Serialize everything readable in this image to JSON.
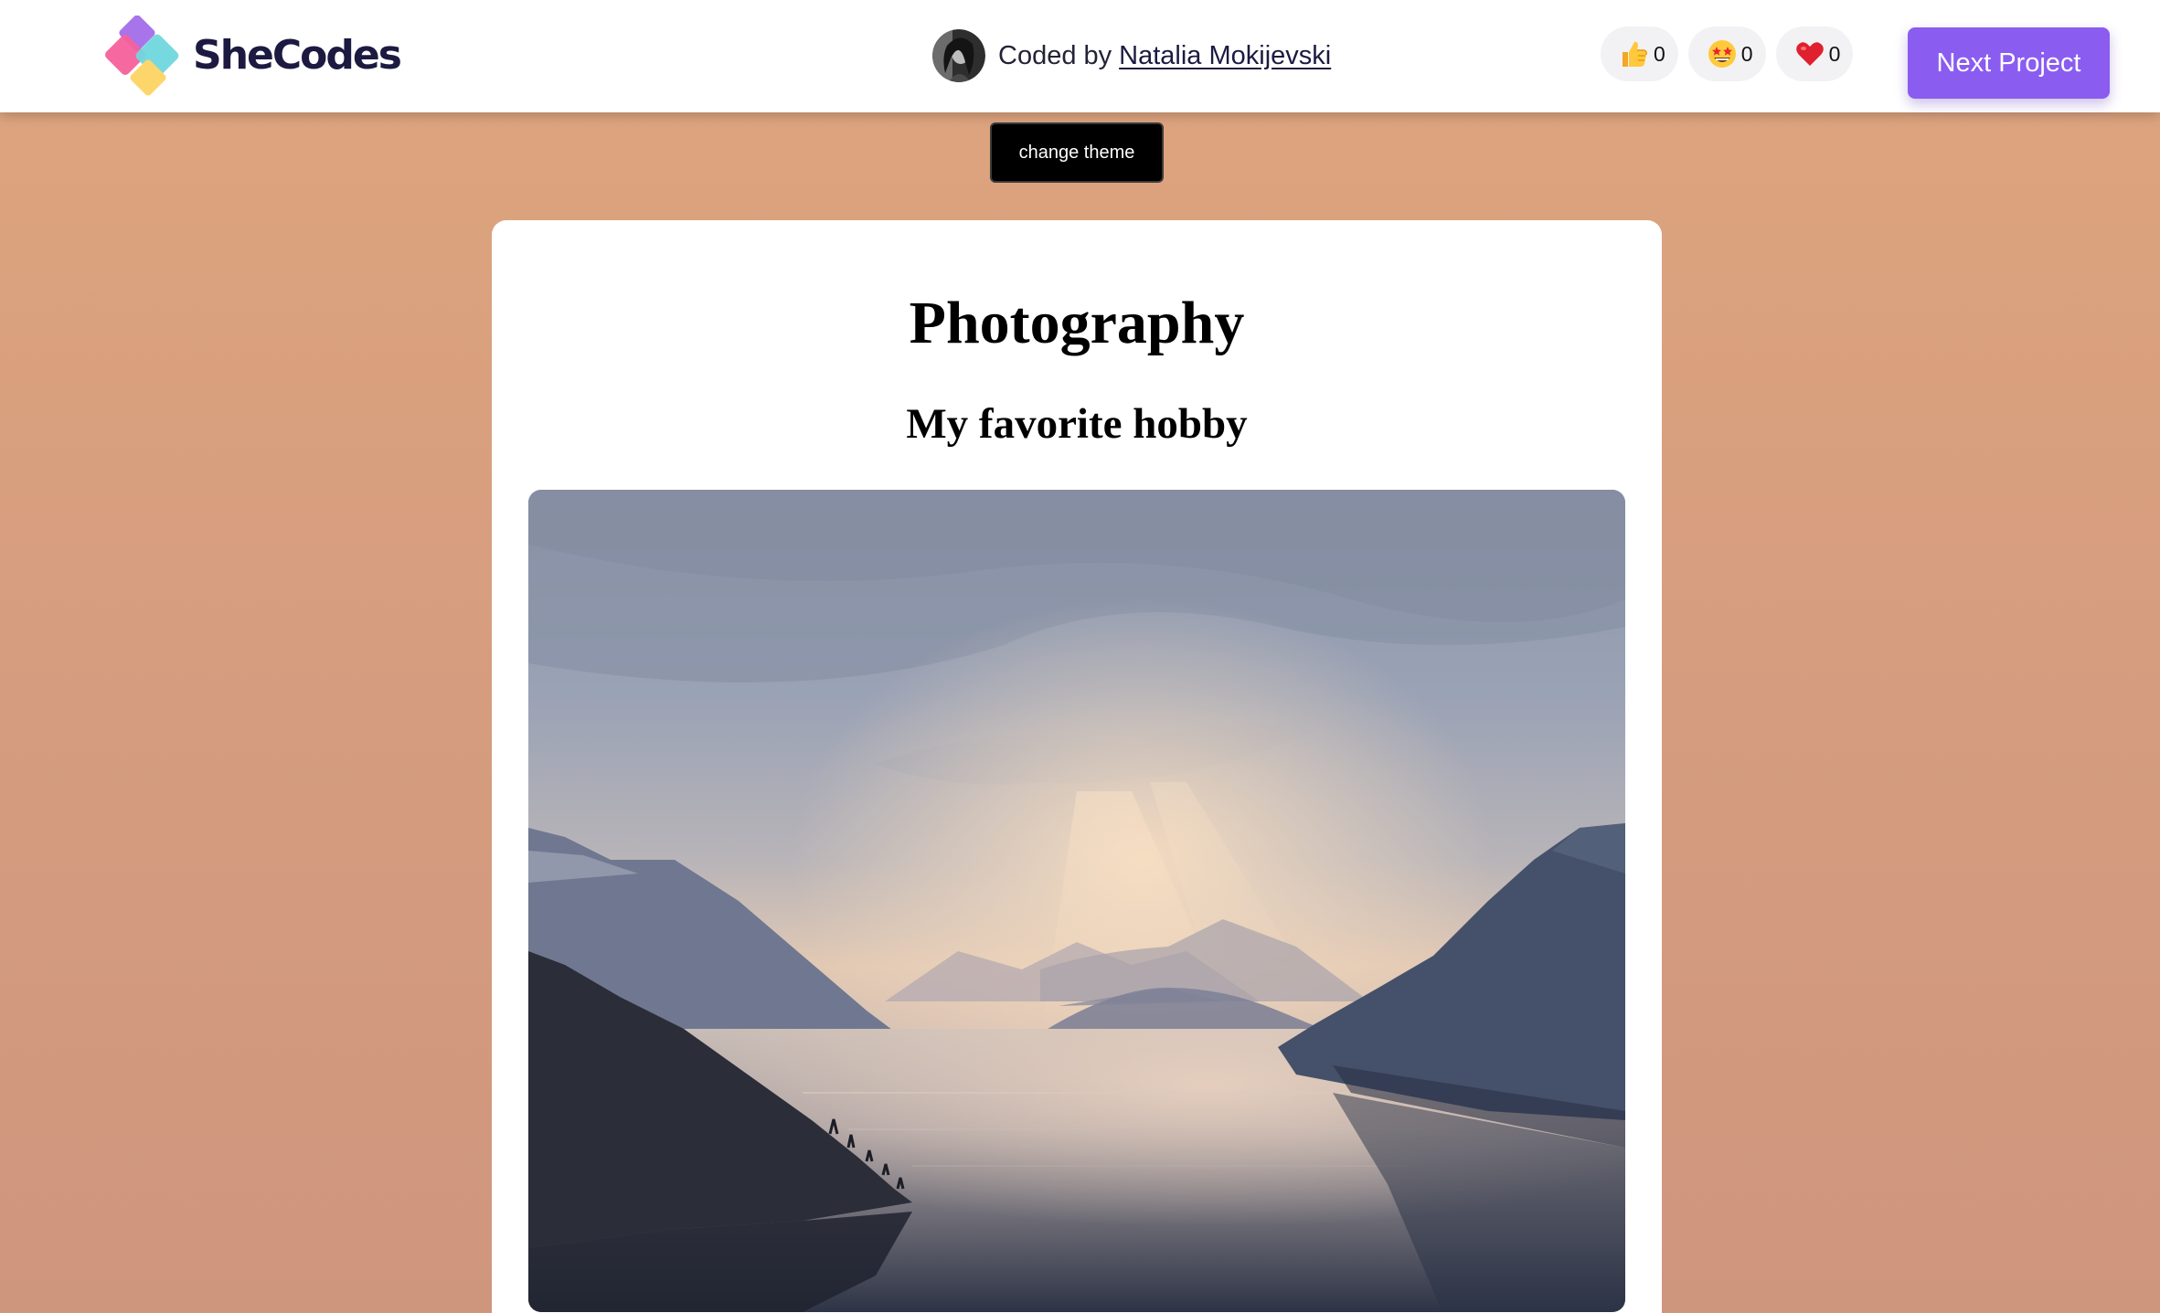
{
  "header": {
    "brand": "SheCodes",
    "coded_prefix": "Coded by",
    "author_name": "Natalia Mokijevski",
    "reactions": [
      {
        "icon": "thumbs-up-icon",
        "count": "0"
      },
      {
        "icon": "star-struck-icon",
        "count": "0"
      },
      {
        "icon": "heart-icon",
        "count": "0"
      }
    ],
    "next_button": "Next Project"
  },
  "theme_button": "change theme",
  "card": {
    "title": "Photography",
    "subtitle": "My favorite hobby"
  },
  "colors": {
    "accent": "#8a5cf0",
    "page_background": "#dba37f",
    "brand_text": "#1c1a41"
  }
}
